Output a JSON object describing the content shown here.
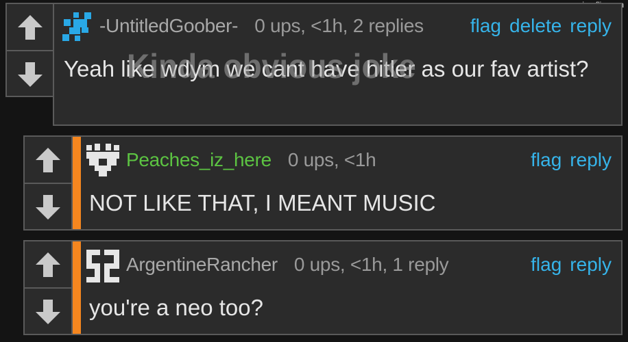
{
  "watermark": "imgflip.com",
  "overlay_text": "Kinda obvious joke",
  "comments": [
    {
      "username": "-UntitledGoober-",
      "stats": "0 ups, <1h, 2 replies",
      "actions": [
        "flag",
        "delete",
        "reply"
      ],
      "text": "Yeah like wdym we cant have hitler as our fav artist?",
      "avatar": "blue-pixel-avatar"
    },
    {
      "username": "Peaches_iz_here",
      "stats": "0 ups, <1h",
      "actions": [
        "flag",
        "reply"
      ],
      "text": "NOT LIKE THAT, I MEANT MUSIC",
      "avatar": "white-pixel-avatar",
      "reply_marker_color": "#f5861f"
    },
    {
      "username": "ArgentineRancher",
      "stats": "0 ups, <1h, 1 reply",
      "actions": [
        "flag",
        "reply"
      ],
      "text": "you're a neo too?",
      "avatar": "white-pixel-avatar",
      "reply_marker_color": "#f5861f"
    }
  ],
  "colors": {
    "link": "#36b4ea",
    "username_green": "#5cc342",
    "background": "#141414",
    "panel": "#2b2b2b"
  }
}
